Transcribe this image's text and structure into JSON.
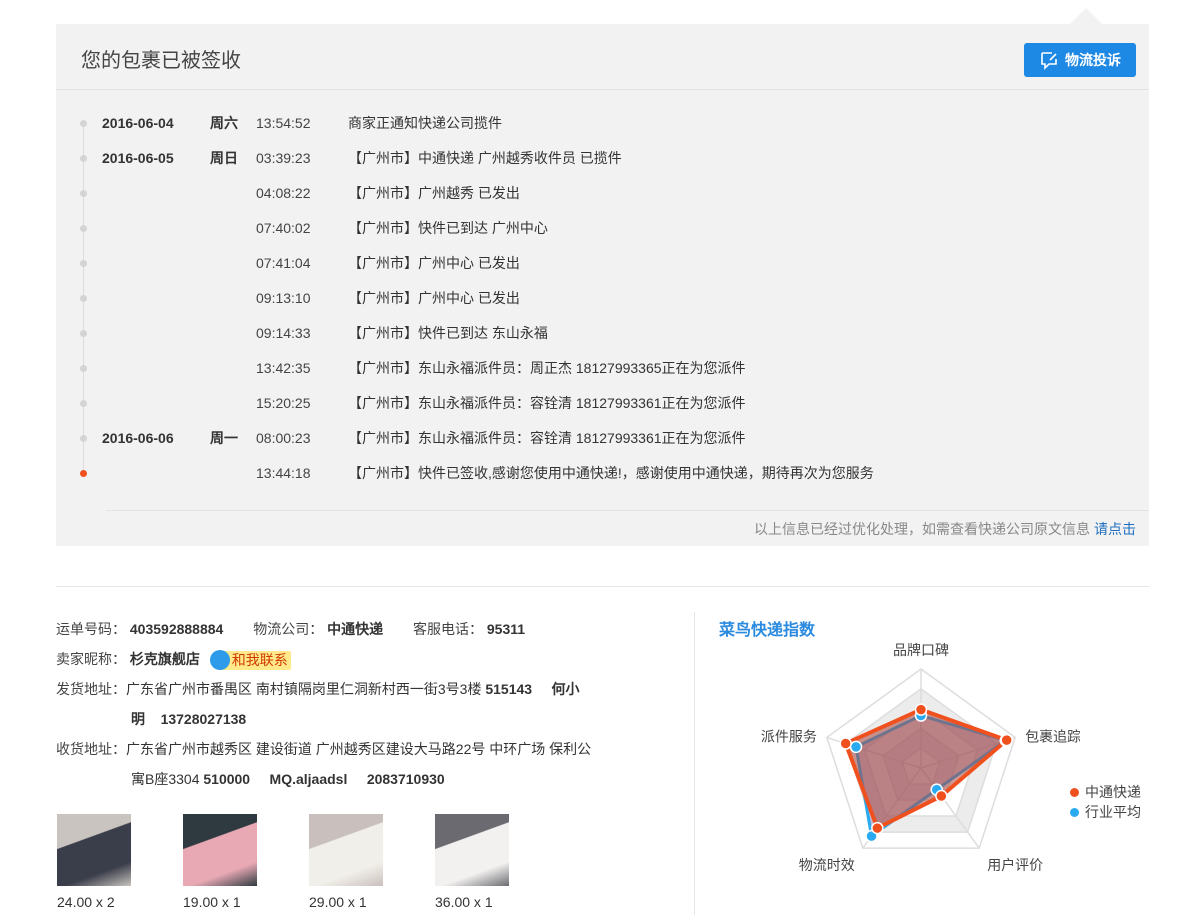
{
  "header": {
    "title": "您的包裹已被签收",
    "complain_label": "物流投诉"
  },
  "timeline": [
    {
      "date": "2016-06-04",
      "weekday": "周六",
      "time": "13:54:52",
      "desc": "商家正通知快递公司揽件"
    },
    {
      "date": "2016-06-05",
      "weekday": "周日",
      "time": "03:39:23",
      "desc": "【广州市】中通快递 广州越秀收件员 已揽件"
    },
    {
      "date": "",
      "weekday": "",
      "time": "04:08:22",
      "desc": "【广州市】广州越秀 已发出"
    },
    {
      "date": "",
      "weekday": "",
      "time": "07:40:02",
      "desc": "【广州市】快件已到达 广州中心"
    },
    {
      "date": "",
      "weekday": "",
      "time": "07:41:04",
      "desc": "【广州市】广州中心 已发出"
    },
    {
      "date": "",
      "weekday": "",
      "time": "09:13:10",
      "desc": "【广州市】广州中心 已发出"
    },
    {
      "date": "",
      "weekday": "",
      "time": "09:14:33",
      "desc": "【广州市】快件已到达 东山永福"
    },
    {
      "date": "",
      "weekday": "",
      "time": "13:42:35",
      "desc": "【广州市】东山永福派件员：周正杰 18127993365正在为您派件"
    },
    {
      "date": "",
      "weekday": "",
      "time": "15:20:25",
      "desc": "【广州市】东山永福派件员：容铨清 18127993361正在为您派件"
    },
    {
      "date": "2016-06-06",
      "weekday": "周一",
      "time": "08:00:23",
      "desc": "【广州市】东山永福派件员：容铨清 18127993361正在为您派件"
    },
    {
      "date": "",
      "weekday": "",
      "time": "13:44:18",
      "desc": "【广州市】快件已签收,感谢您使用中通快递!，感谢使用中通快递，期待再次为您服务",
      "current": true
    }
  ],
  "footer": {
    "note": "以上信息已经过优化处理，如需查看快递公司原文信息",
    "link": "请点击"
  },
  "info": {
    "waybill_label": "运单号码：",
    "waybill": "403592888884",
    "company_label": "物流公司：",
    "company": "中通快递",
    "phone_label": "客服电话：",
    "phone": "95311",
    "seller_label": "卖家昵称：",
    "seller": "杉克旗舰店",
    "contact": "和我联系",
    "ship_label": "发货地址：",
    "ship_addr": "广东省广州市番禺区 南村镇隔岗里仁洞新村西一街3号3楼",
    "ship_zip": "515143",
    "ship_name_1": "何小",
    "ship_name_2": "明",
    "ship_phone": "13728027138",
    "recv_label": "收货地址：",
    "recv_addr_1": "广东省广州市越秀区 建设街道 广州越秀区建设大马路22号 中环广场 保利公",
    "recv_addr_2": "寓B座3304",
    "recv_zip": "510000",
    "recv_name": "MQ.aljaadsl",
    "recv_phone": "2083710930"
  },
  "products": [
    {
      "caption": "24.00 x 2",
      "colors": [
        "#3a3d4a",
        "#c9c4bf"
      ]
    },
    {
      "caption": "19.00 x 1",
      "colors": [
        "#e9a9b4",
        "#2e3a40"
      ]
    },
    {
      "caption": "29.00 x 1",
      "colors": [
        "#f1efe9",
        "#c9c0bd"
      ]
    },
    {
      "caption": "36.00 x 1",
      "colors": [
        "#f3f1ef",
        "#6a6a70"
      ]
    }
  ],
  "chart_data": {
    "type": "radar",
    "title": "菜鸟快递指数",
    "axes": [
      "品牌口碑",
      "包裹追踪",
      "用户评价",
      "物流时效",
      "派件服务"
    ],
    "range": [
      0,
      100
    ],
    "legend_position": "right",
    "series": [
      {
        "name": "中通快递",
        "color": "#f0501e",
        "values": [
          59,
          91,
          35,
          75,
          80
        ]
      },
      {
        "name": "行业平均",
        "color": "#2aaaf0",
        "values": [
          53,
          90,
          27,
          85,
          69
        ]
      }
    ]
  }
}
